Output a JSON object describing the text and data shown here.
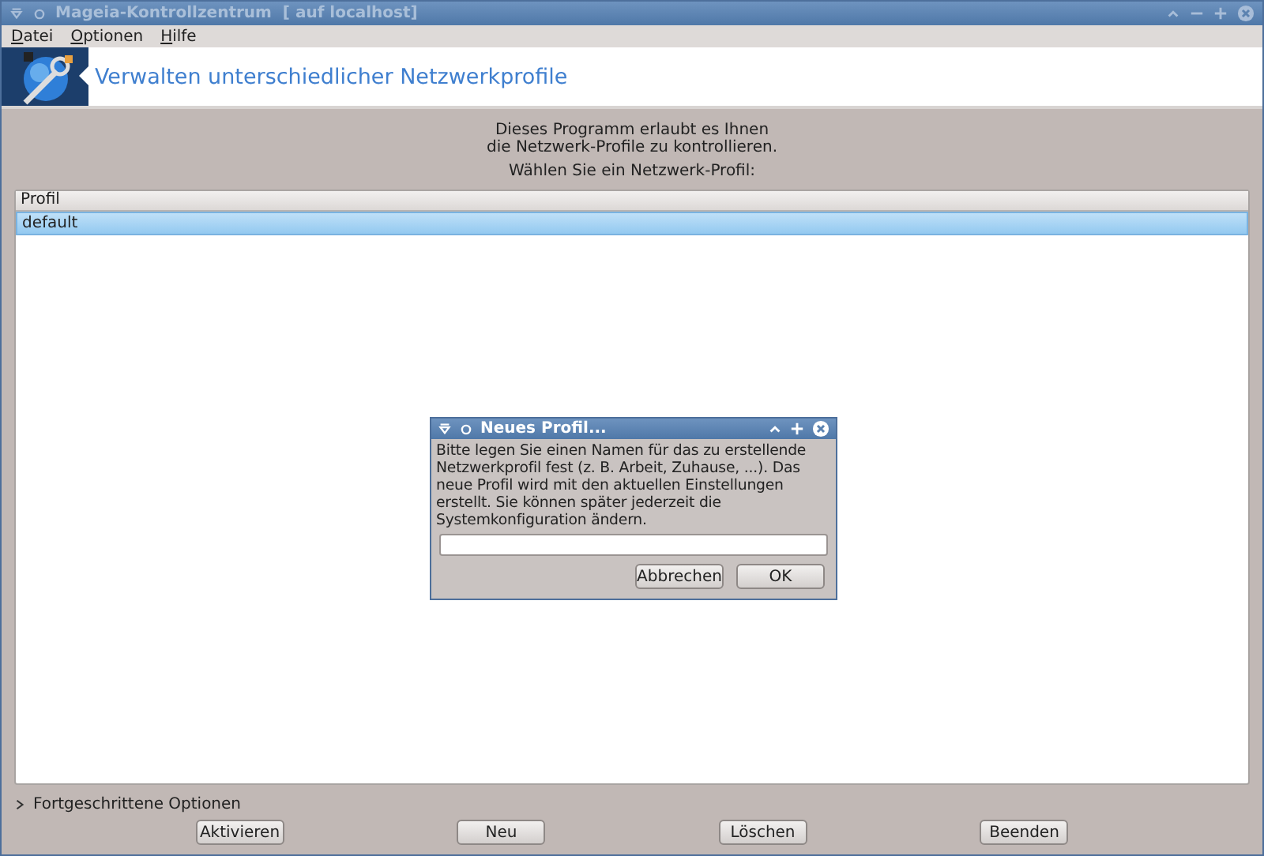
{
  "window": {
    "title": "Mageia-Kontrollzentrum  [ auf localhost]"
  },
  "menu": [
    "Datei",
    "Optionen",
    "Hilfe"
  ],
  "header": {
    "title": "Verwalten unterschiedlicher Netzwerkprofile"
  },
  "intro": [
    "Dieses Programm erlaubt es Ihnen",
    "die Netzwerk-Profile zu kontrollieren."
  ],
  "prompt": "Wählen Sie ein Netzwerk-Profil:",
  "table": {
    "columns": [
      "Profil"
    ],
    "rows": [
      {
        "name": "default",
        "selected": true
      }
    ]
  },
  "advanced": {
    "label": "Fortgeschrittene Optionen",
    "expanded": false
  },
  "buttons": [
    "Aktivieren",
    "Neu",
    "Löschen",
    "Beenden"
  ],
  "dialog": {
    "title": "Neues Profil...",
    "message": "Bitte legen Sie einen Namen für das zu erstellende Netzwerkprofil fest (z. B. Arbeit, Zuhause, ...). Das neue Profil wird mit den aktuellen Einstellungen erstellt. Sie können später jederzeit die Systemkonfiguration ändern.",
    "buttons": [
      "Abbrechen",
      "OK"
    ]
  }
}
